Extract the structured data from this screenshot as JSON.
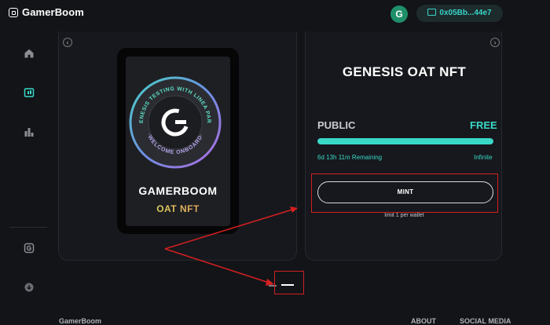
{
  "header": {
    "brand": "GamerBoom",
    "avatar_letter": "G",
    "wallet_address": "0x05Bb...44e7"
  },
  "sidebar": {
    "items": [
      {
        "icon": "home-icon"
      },
      {
        "icon": "wallet-icon",
        "active": true
      },
      {
        "icon": "leaderboard-icon"
      },
      {
        "icon": "gamerboom-icon"
      },
      {
        "icon": "download-icon"
      }
    ]
  },
  "nft_card": {
    "badge_ring_top": "GENESIS TESTING WITH LINEA PARK",
    "badge_ring_bottom": "·WELCOME ONBOARD·",
    "title": "GAMERBOOM",
    "subtitle": "OAT NFT"
  },
  "mint_panel": {
    "title": "GENESIS OAT NFT",
    "phase": "PUBLIC",
    "price": "FREE",
    "progress_fraction": 1.0,
    "remaining": "6d 13h 11m Remaining",
    "supply": "Infinite",
    "mint_label": "MINT",
    "limit_note": "limit 1 per wallet"
  },
  "colors": {
    "accent": "#3ad8c7",
    "annotation": "#d32020",
    "background": "#121418"
  },
  "footer": {
    "brand_cut": "GamerBoom",
    "link1": "ABOUT",
    "link2": "SOCIAL MEDIA"
  }
}
